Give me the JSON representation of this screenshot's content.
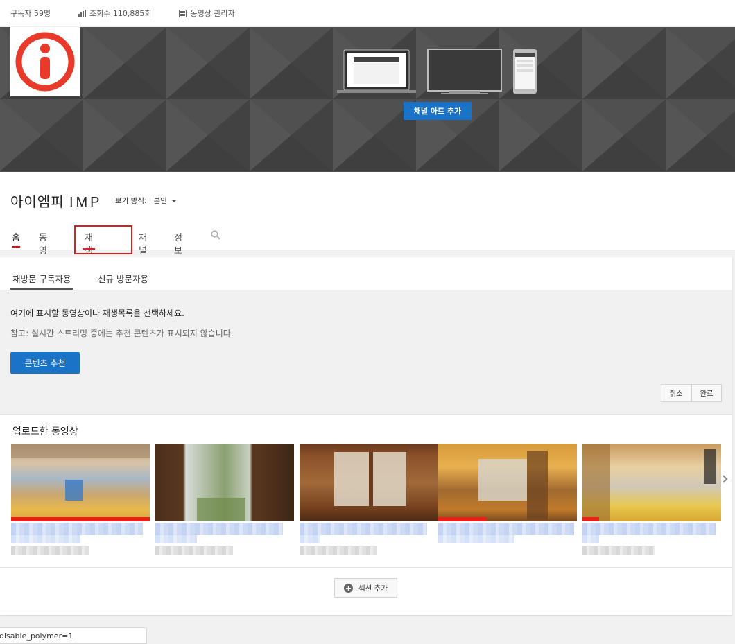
{
  "topbar": {
    "subscribers": "구독자 59명",
    "views": "조회수 110,885회",
    "video_manager": "동영상 관리자"
  },
  "banner": {
    "add_art_label": "채널 아트 추가",
    "bg_color": "#4b4b4b",
    "avatar_color": "#e8392a"
  },
  "channel": {
    "title_hangul": "아이엠피 ",
    "title_latin": "IMP",
    "view_as_label": "보기 방식:",
    "view_as_value": "본인"
  },
  "tabs": [
    {
      "label": "홈",
      "active": true
    },
    {
      "label": "동영상",
      "active": false
    },
    {
      "label": "재생목록",
      "active": false,
      "highlighted": true
    },
    {
      "label": "채널",
      "active": false
    },
    {
      "label": "정보",
      "active": false
    }
  ],
  "subtabs": [
    {
      "label": "재방문 구독자용",
      "active": true
    },
    {
      "label": "신규 방문자용",
      "active": false
    }
  ],
  "edit_panel": {
    "line1": "여기에 표시할 동영상이나 재생목록을 선택하세요.",
    "line2": "참고: 실시간 스트리밍 중에는 추천 콘텐츠가 표시되지 않습니다.",
    "recommend_button": "콘텐츠 추천",
    "cancel_button": "취소",
    "done_button": "완료"
  },
  "section": {
    "title": "업로드한 동영상"
  },
  "add_section_label": "섹션 추가",
  "status_url": "disable_polymer=1",
  "colors": {
    "accent_blue": "#1a73c6",
    "tab_red": "#cc181e",
    "highlight_red": "#d91e1e"
  }
}
